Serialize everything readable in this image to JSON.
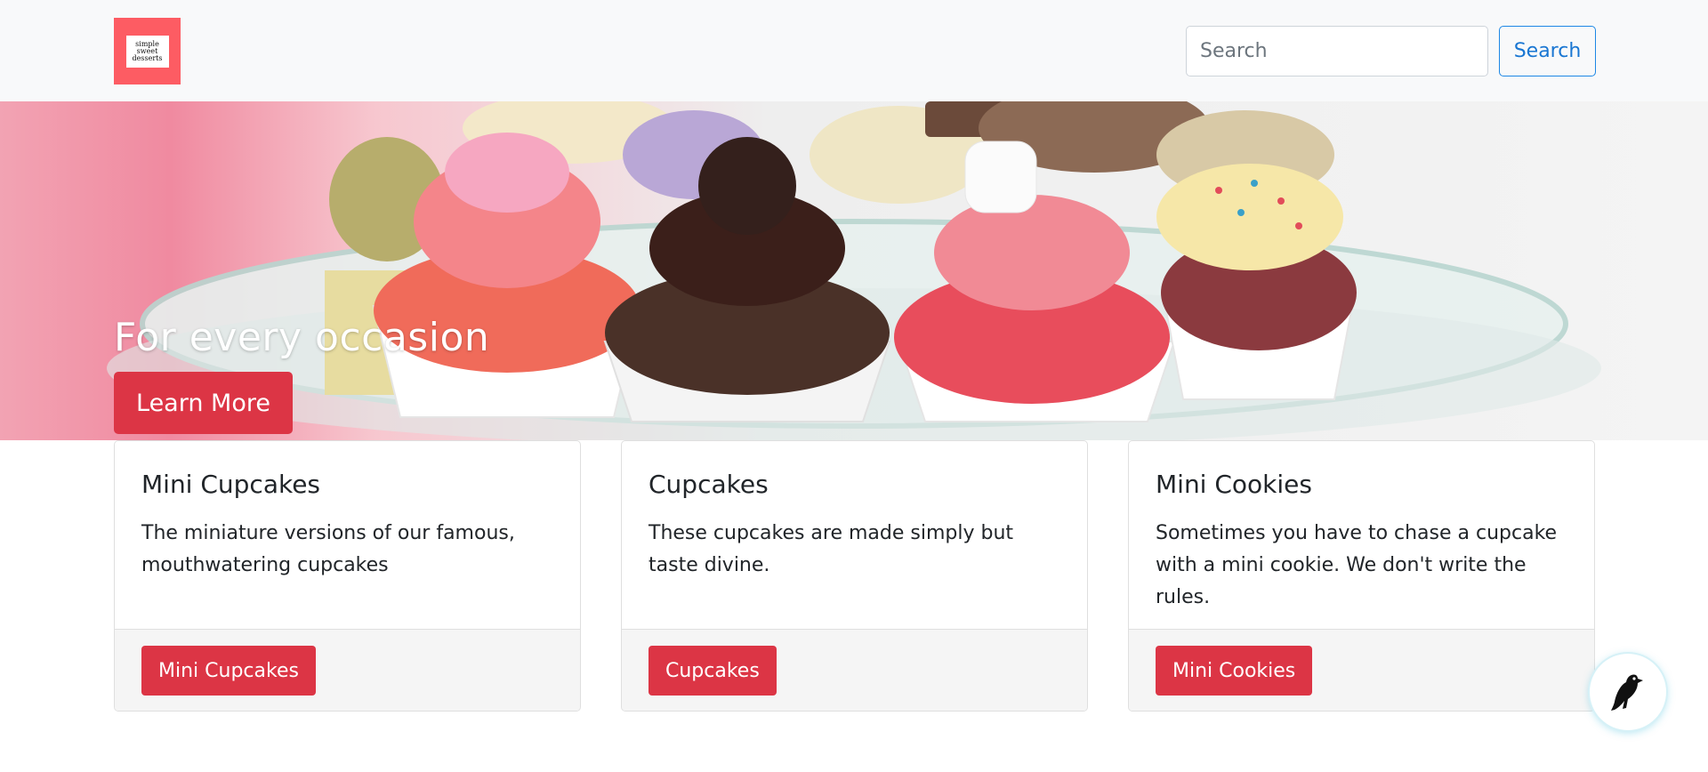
{
  "brand": {
    "logo_lines": [
      "simple",
      "sweet",
      "desserts"
    ],
    "logo_color": "#fd5c63"
  },
  "search": {
    "placeholder": "Search",
    "value": "",
    "button_label": "Search"
  },
  "hero": {
    "title": "For every occasion",
    "button_label": "Learn More"
  },
  "cards": [
    {
      "title": "Mini Cupcakes",
      "text": "The miniature versions of our famous, mouthwatering cupcakes",
      "button_label": "Mini Cupcakes"
    },
    {
      "title": "Cupcakes",
      "text": "These cupcakes are made simply but taste divine.",
      "button_label": "Cupcakes"
    },
    {
      "title": "Mini Cookies",
      "text": "Sometimes you have to chase a cupcake with a mini cookie. We don't write the rules.",
      "button_label": "Mini Cookies"
    }
  ],
  "floating_widget": {
    "icon": "bird-icon"
  },
  "colors": {
    "accent": "#dc3545",
    "search_button": "#1976d2",
    "navbar_bg": "#f8f9fa"
  }
}
